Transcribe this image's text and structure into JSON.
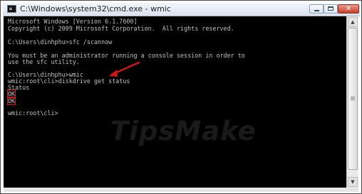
{
  "window": {
    "title": "C:\\Windows\\system32\\cmd.exe - wmic",
    "icon": "cmd-icon",
    "controls": {
      "minimize": "minimize-icon",
      "maximize": "maximize-icon",
      "close": "close-icon",
      "close_glyph": "✕"
    }
  },
  "console": {
    "lines": [
      "Microsoft Windows [Version 6.1.7600]",
      "Copyright (c) 2009 Microsoft Corporation.  All rights reserved.",
      "",
      "C:\\Users\\dinhphu>sfc /scannow",
      "",
      "You must be an administrator running a console session in order to",
      "use the sfc utility.",
      "",
      "C:\\Users\\dinhphu>wmic",
      "wmic:root\\cli>diskdrive get status",
      "Status",
      "OK",
      "OK",
      "",
      "wmic:root\\cli>"
    ],
    "text_color": "#c0c0c0",
    "background": "#000000",
    "highlight_color": "#d01818",
    "watermark": "TipsMake"
  },
  "scrollbar": {
    "up_glyph": "▲",
    "down_glyph": "▼"
  }
}
